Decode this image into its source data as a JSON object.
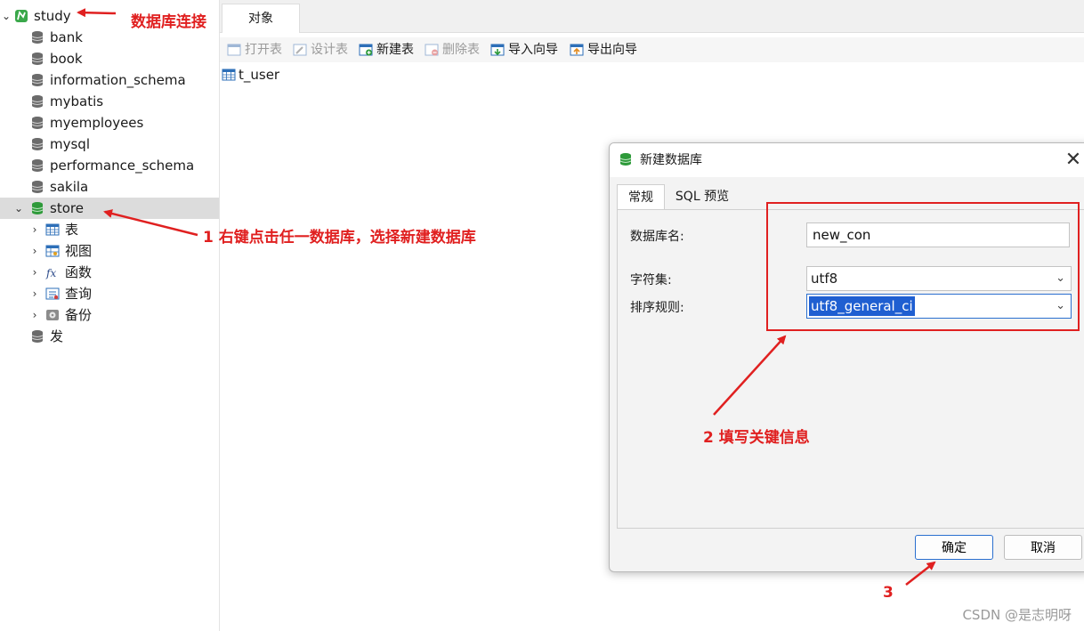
{
  "colors": {
    "accent_red": "#e02020",
    "db_icon_gray": "#6b6b6b",
    "db_icon_green": "#2e9a3a",
    "selection_blue": "#1f5fd1",
    "tree_selected_bg": "#dcdcdc"
  },
  "tree": {
    "connection": {
      "label": "study",
      "icon": "connection-icon"
    },
    "databases": [
      "bank",
      "book",
      "information_schema",
      "mybatis",
      "myemployees",
      "mysql",
      "performance_schema",
      "sakila"
    ],
    "selected_db": {
      "label": "store",
      "icon": "database-open-icon"
    },
    "children": [
      {
        "label": "表",
        "icon": "table-icon"
      },
      {
        "label": "视图",
        "icon": "view-icon"
      },
      {
        "label": "函数",
        "icon": "function-icon",
        "glyph": "fx"
      },
      {
        "label": "查询",
        "icon": "query-icon"
      },
      {
        "label": "备份",
        "icon": "backup-icon"
      }
    ],
    "last_db": "发"
  },
  "main": {
    "tab_label": "对象",
    "toolbar": [
      {
        "label": "打开表",
        "icon": "open-table-icon",
        "enabled": false
      },
      {
        "label": "设计表",
        "icon": "design-table-icon",
        "enabled": false
      },
      {
        "label": "新建表",
        "icon": "new-table-icon",
        "enabled": true
      },
      {
        "label": "删除表",
        "icon": "delete-table-icon",
        "enabled": false
      },
      {
        "label": "导入向导",
        "icon": "import-wizard-icon",
        "enabled": true
      },
      {
        "label": "导出向导",
        "icon": "export-wizard-icon",
        "enabled": true
      }
    ],
    "tables": [
      "t_user"
    ]
  },
  "dialog": {
    "title": "新建数据库",
    "close_glyph": "✕",
    "tabs": [
      "常规",
      "SQL 预览"
    ],
    "fields": {
      "name_label": "数据库名:",
      "name_value": "new_con",
      "charset_label": "字符集:",
      "charset_value": "utf8",
      "collation_label": "排序规则:",
      "collation_value": "utf8_general_ci"
    },
    "ok_label": "确定",
    "cancel_label": "取消"
  },
  "annotations": {
    "connection_note": "数据库连接",
    "step1": "1 右键点击任一数据库，选择新建数据库",
    "step2": "2 填写关键信息",
    "step3": "3"
  },
  "watermark": "CSDN @是志明呀"
}
